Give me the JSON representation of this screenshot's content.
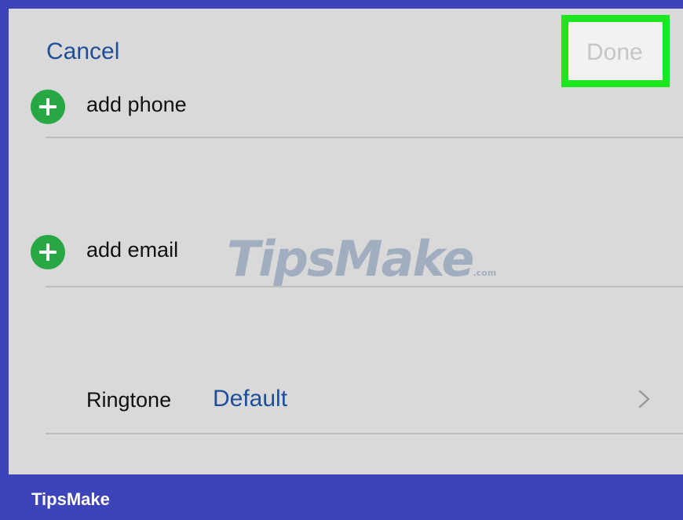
{
  "nav": {
    "cancel_label": "Cancel",
    "done_label": "Done"
  },
  "rows": {
    "add_phone_label": "add phone",
    "add_email_label": "add email",
    "ringtone_label": "Ringtone",
    "ringtone_value": "Default"
  },
  "icons": {
    "add_phone": "plus-circle-icon",
    "add_email": "plus-circle-icon",
    "ringtone_chevron": "chevron-right-icon"
  },
  "watermark": {
    "text": "TipsMake"
  },
  "footer": {
    "brand": "TipsMake"
  },
  "colors": {
    "frame": "#3d43b8",
    "screen_bg": "#d9d9d9",
    "link_blue": "#1f4e9a",
    "add_green": "#27a844",
    "highlight_green": "#1ee61e",
    "done_disabled": "#c6c6c6"
  }
}
